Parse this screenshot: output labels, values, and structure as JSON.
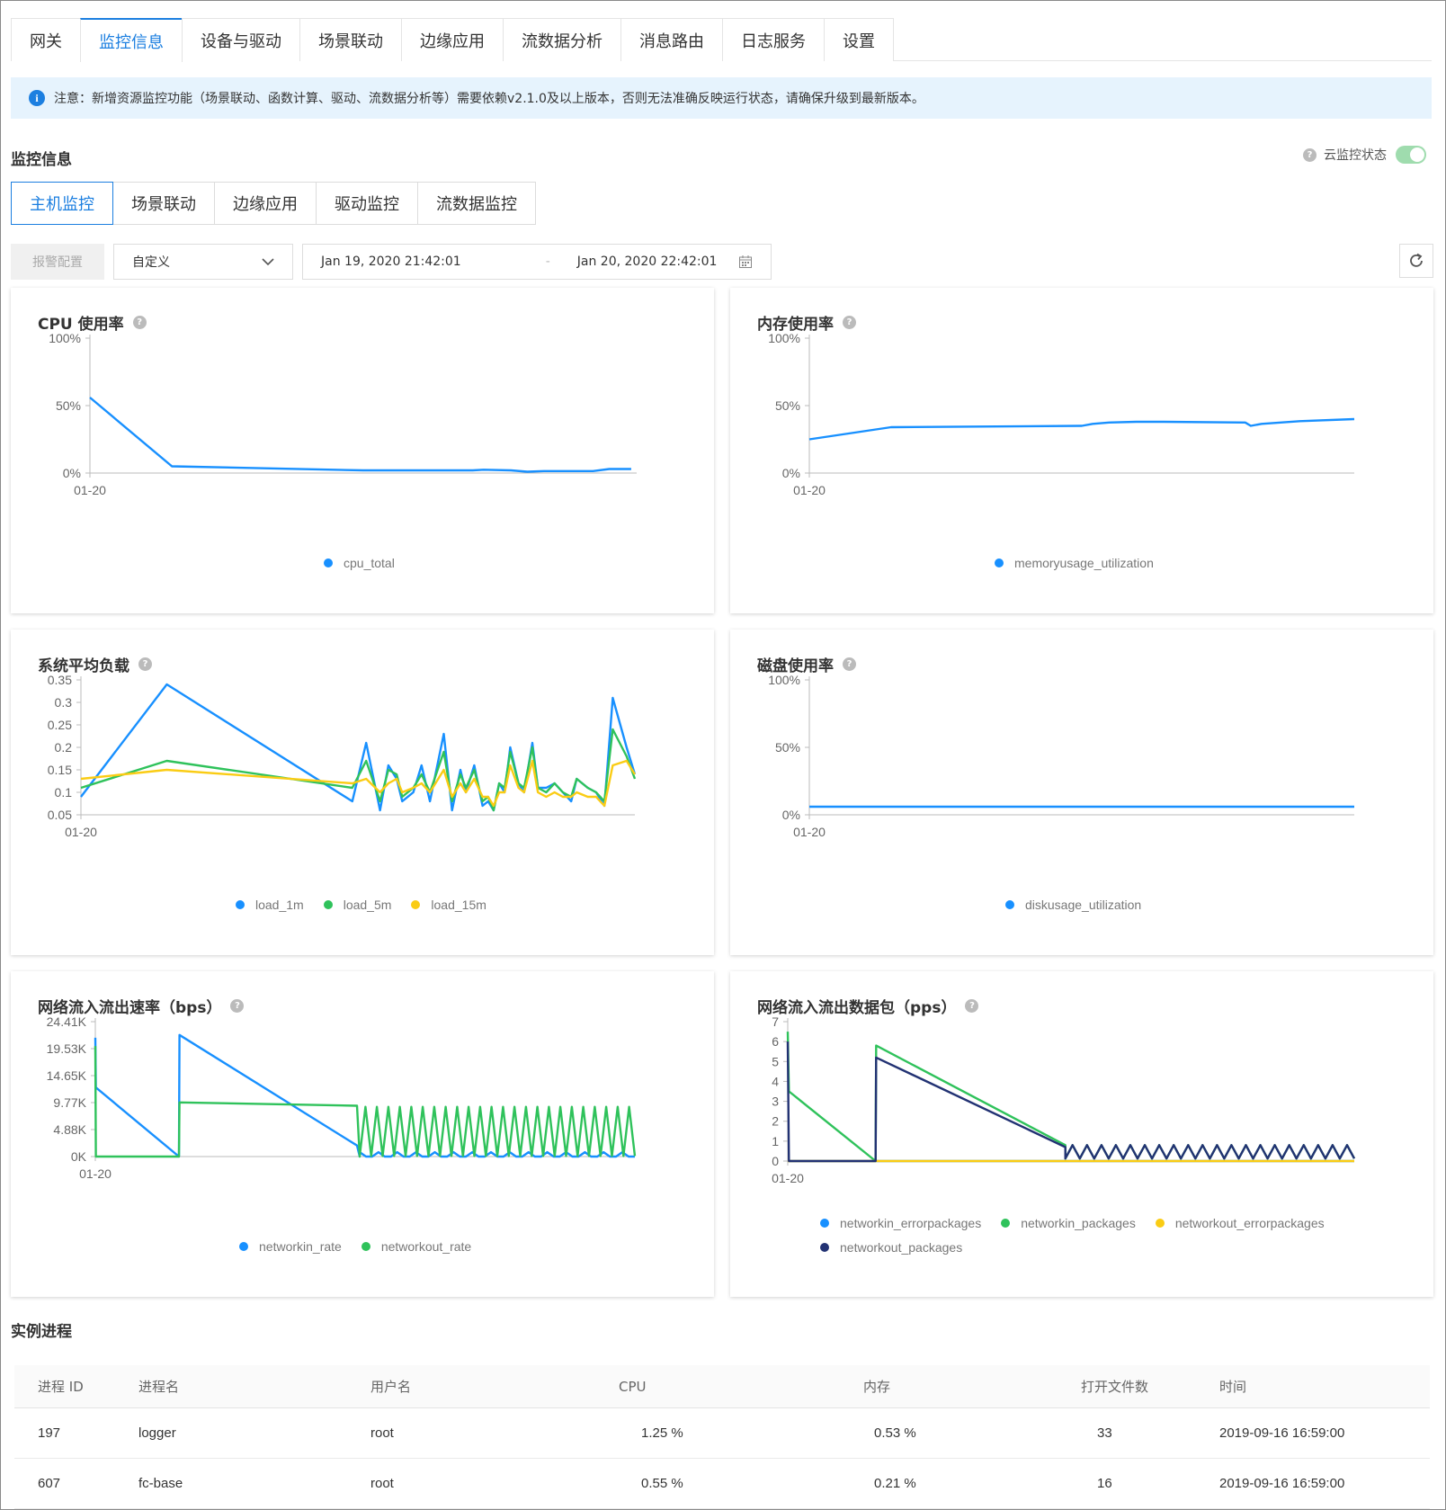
{
  "nav_tabs": [
    {
      "label": "网关"
    },
    {
      "label": "监控信息"
    },
    {
      "label": "设备与驱动"
    },
    {
      "label": "场景联动"
    },
    {
      "label": "边缘应用"
    },
    {
      "label": "流数据分析"
    },
    {
      "label": "消息路由"
    },
    {
      "label": "日志服务"
    },
    {
      "label": "设置"
    }
  ],
  "active_tab": "监控信息",
  "notice": "注意：新增资源监控功能（场景联动、函数计算、驱动、流数据分析等）需要依赖v2.1.0及以上版本，否则无法准确反映运行状态，请确保升级到最新版本。",
  "section_title": "监控信息",
  "cloud_status_label": "云监控状态",
  "cloud_status_on": true,
  "sub_tabs": [
    {
      "label": "主机监控"
    },
    {
      "label": "场景联动"
    },
    {
      "label": "边缘应用"
    },
    {
      "label": "驱动监控"
    },
    {
      "label": "流数据监控"
    }
  ],
  "active_sub_tab": "主机监控",
  "alarm_button": "报警配置",
  "time_select": "自定义",
  "date_start": "Jan 19, 2020 21:42:01",
  "date_sep": "-",
  "date_end": "Jan 20, 2020 22:42:01",
  "colors": {
    "blue": "#1890ff",
    "green": "#2fc25b",
    "yellow": "#facc14",
    "navy": "#223273",
    "accent": "#1c7fe0"
  },
  "chart_data": [
    {
      "id": "cpu",
      "type": "line",
      "title": "CPU 使用率",
      "x_ticks": [
        "01-20"
      ],
      "y_ticks": [
        "100%",
        "50%",
        "0%"
      ],
      "ylim": [
        0,
        100
      ],
      "legend": [
        "cpu_total"
      ],
      "series": [
        {
          "name": "cpu_total",
          "color": "blue",
          "values": [
            [
              0,
              56
            ],
            [
              15,
              5
            ],
            [
              50,
              2
            ],
            [
              55,
              2
            ],
            [
              70,
              2
            ],
            [
              72,
              2.5
            ],
            [
              77,
              2
            ],
            [
              80,
              1
            ],
            [
              83,
              1.5
            ],
            [
              88,
              1.5
            ],
            [
              92,
              1.5
            ],
            [
              95,
              3
            ],
            [
              99,
              3
            ]
          ]
        }
      ]
    },
    {
      "id": "mem",
      "type": "line",
      "title": "内存使用率",
      "x_ticks": [
        "01-20"
      ],
      "y_ticks": [
        "100%",
        "50%",
        "0%"
      ],
      "ylim": [
        0,
        100
      ],
      "legend": [
        "memoryusage_utilization"
      ],
      "series": [
        {
          "name": "memoryusage_utilization",
          "color": "blue",
          "values": [
            [
              0,
              25
            ],
            [
              15,
              34
            ],
            [
              50,
              35
            ],
            [
              52,
              36.5
            ],
            [
              55,
              37.5
            ],
            [
              60,
              38
            ],
            [
              65,
              38
            ],
            [
              80,
              37.5
            ],
            [
              81,
              35
            ],
            [
              83,
              36.5
            ],
            [
              90,
              38.5
            ],
            [
              100,
              40
            ]
          ]
        }
      ]
    },
    {
      "id": "load",
      "type": "line",
      "title": "系统平均负载",
      "x_ticks": [
        "01-20"
      ],
      "y_ticks": [
        "0.35",
        "0.3",
        "0.25",
        "0.2",
        "0.15",
        "0.1",
        "0.05"
      ],
      "ylim": [
        0.05,
        0.35
      ],
      "legend": [
        "load_1m",
        "load_5m",
        "load_15m"
      ],
      "series": [
        {
          "name": "load_1m",
          "color": "blue",
          "values": [
            [
              0,
              0.09
            ],
            [
              15.5,
              0.34
            ],
            [
              49,
              0.08
            ],
            [
              51.5,
              0.21
            ],
            [
              54,
              0.06
            ],
            [
              55.5,
              0.16
            ],
            [
              57,
              0.13
            ],
            [
              58,
              0.08
            ],
            [
              60,
              0.1
            ],
            [
              61.5,
              0.16
            ],
            [
              63,
              0.08
            ],
            [
              65.5,
              0.23
            ],
            [
              67,
              0.06
            ],
            [
              68.5,
              0.15
            ],
            [
              69.5,
              0.1
            ],
            [
              71,
              0.16
            ],
            [
              72.5,
              0.07
            ],
            [
              73.5,
              0.08
            ],
            [
              74.5,
              0.06
            ],
            [
              75.5,
              0.12
            ],
            [
              76.5,
              0.1
            ],
            [
              77.5,
              0.2
            ],
            [
              79,
              0.12
            ],
            [
              80,
              0.1
            ],
            [
              81.5,
              0.21
            ],
            [
              82.5,
              0.11
            ],
            [
              84,
              0.11
            ],
            [
              85.5,
              0.12
            ],
            [
              87,
              0.1
            ],
            [
              88.5,
              0.08
            ],
            [
              89.5,
              0.13
            ],
            [
              91.5,
              0.11
            ],
            [
              93,
              0.1
            ],
            [
              94.5,
              0.07
            ],
            [
              96,
              0.31
            ],
            [
              98.5,
              0.2
            ],
            [
              100,
              0.14
            ]
          ]
        },
        {
          "name": "load_5m",
          "color": "green",
          "values": [
            [
              0,
              0.11
            ],
            [
              15.5,
              0.17
            ],
            [
              49,
              0.11
            ],
            [
              51.5,
              0.17
            ],
            [
              54,
              0.08
            ],
            [
              55.5,
              0.15
            ],
            [
              57,
              0.14
            ],
            [
              58,
              0.09
            ],
            [
              60,
              0.11
            ],
            [
              61.5,
              0.14
            ],
            [
              63,
              0.1
            ],
            [
              65.5,
              0.19
            ],
            [
              67,
              0.08
            ],
            [
              68.5,
              0.14
            ],
            [
              69.5,
              0.11
            ],
            [
              71,
              0.15
            ],
            [
              72.5,
              0.08
            ],
            [
              73.5,
              0.09
            ],
            [
              74.5,
              0.06
            ],
            [
              75.5,
              0.12
            ],
            [
              76.5,
              0.11
            ],
            [
              77.5,
              0.19
            ],
            [
              79,
              0.12
            ],
            [
              80,
              0.11
            ],
            [
              81.5,
              0.2
            ],
            [
              82.5,
              0.11
            ],
            [
              84,
              0.1
            ],
            [
              85.5,
              0.12
            ],
            [
              87,
              0.1
            ],
            [
              88.5,
              0.09
            ],
            [
              89.5,
              0.13
            ],
            [
              91.5,
              0.11
            ],
            [
              93,
              0.1
            ],
            [
              94.5,
              0.08
            ],
            [
              96,
              0.24
            ],
            [
              98.5,
              0.18
            ],
            [
              100,
              0.13
            ]
          ]
        },
        {
          "name": "load_15m",
          "color": "yellow",
          "values": [
            [
              0,
              0.13
            ],
            [
              15.5,
              0.15
            ],
            [
              49,
              0.12
            ],
            [
              51.5,
              0.13
            ],
            [
              54,
              0.1
            ],
            [
              55.5,
              0.12
            ],
            [
              57,
              0.13
            ],
            [
              58,
              0.1
            ],
            [
              60,
              0.11
            ],
            [
              61.5,
              0.12
            ],
            [
              63,
              0.1
            ],
            [
              65.5,
              0.15
            ],
            [
              67,
              0.09
            ],
            [
              68.5,
              0.12
            ],
            [
              69.5,
              0.1
            ],
            [
              71,
              0.13
            ],
            [
              72.5,
              0.09
            ],
            [
              73.5,
              0.09
            ],
            [
              74.5,
              0.07
            ],
            [
              75.5,
              0.1
            ],
            [
              76.5,
              0.1
            ],
            [
              77.5,
              0.16
            ],
            [
              79,
              0.11
            ],
            [
              80,
              0.1
            ],
            [
              81.5,
              0.17
            ],
            [
              82.5,
              0.1
            ],
            [
              84,
              0.09
            ],
            [
              85.5,
              0.1
            ],
            [
              87,
              0.09
            ],
            [
              88.5,
              0.09
            ],
            [
              89.5,
              0.1
            ],
            [
              91.5,
              0.09
            ],
            [
              93,
              0.09
            ],
            [
              94.5,
              0.07
            ],
            [
              96,
              0.16
            ],
            [
              98.5,
              0.17
            ],
            [
              100,
              0.14
            ]
          ]
        }
      ]
    },
    {
      "id": "disk",
      "type": "line",
      "title": "磁盘使用率",
      "x_ticks": [
        "01-20"
      ],
      "y_ticks": [
        "100%",
        "50%",
        "0%"
      ],
      "ylim": [
        0,
        100
      ],
      "legend": [
        "diskusage_utilization"
      ],
      "series": [
        {
          "name": "diskusage_utilization",
          "color": "blue",
          "values": [
            [
              0,
              6
            ],
            [
              100,
              6
            ]
          ]
        }
      ]
    },
    {
      "id": "net_rate",
      "type": "line",
      "title": "网络流入流出速率（bps）",
      "x_ticks": [
        "01-20"
      ],
      "y_ticks": [
        "24.41K",
        "19.53K",
        "14.65K",
        "9.77K",
        "4.88K",
        "0K"
      ],
      "ylim": [
        0,
        24.41
      ],
      "legend": [
        "networkin_rate",
        "networkout_rate"
      ],
      "series": [
        {
          "name": "networkin_rate",
          "color": "blue",
          "values": [
            [
              0,
              21.5
            ],
            [
              0.1,
              12.5
            ],
            [
              15.5,
              0
            ],
            [
              15.6,
              22
            ],
            [
              48.5,
              2
            ],
            [
              49,
              0
            ],
            [
              100,
              0
            ]
          ],
          "jitter": "low"
        },
        {
          "name": "networkout_rate",
          "color": "green",
          "values": [
            [
              0,
              20
            ],
            [
              0.1,
              0
            ],
            [
              15.5,
              0
            ],
            [
              15.6,
              9.8
            ],
            [
              48.5,
              9.2
            ],
            [
              49,
              0
            ],
            [
              100,
              9
            ]
          ],
          "jitter": "high"
        }
      ]
    },
    {
      "id": "net_pkts",
      "type": "line",
      "title": "网络流入流出数据包（pps）",
      "x_ticks": [
        "01-20"
      ],
      "y_ticks": [
        "7",
        "6",
        "5",
        "4",
        "3",
        "2",
        "1",
        "0"
      ],
      "ylim": [
        0,
        7
      ],
      "legend": [
        "networkin_errorpackages",
        "networkin_packages",
        "networkout_errorpackages",
        "networkout_packages"
      ],
      "series": [
        {
          "name": "networkin_errorpackages",
          "color": "blue",
          "values": [
            [
              0,
              0
            ],
            [
              100,
              0
            ]
          ]
        },
        {
          "name": "networkin_packages",
          "color": "green",
          "values": [
            [
              0,
              6.5
            ],
            [
              0.2,
              3.5
            ],
            [
              15.5,
              0
            ],
            [
              15.6,
              5.8
            ],
            [
              49,
              0.8
            ],
            [
              100,
              0.5
            ]
          ],
          "jitter": "mid"
        },
        {
          "name": "networkout_errorpackages",
          "color": "yellow",
          "values": [
            [
              0,
              0
            ],
            [
              100,
              0
            ]
          ]
        },
        {
          "name": "networkout_packages",
          "color": "navy",
          "values": [
            [
              0,
              6
            ],
            [
              0.2,
              0
            ],
            [
              15.5,
              0
            ],
            [
              15.6,
              5.2
            ],
            [
              49,
              0.7
            ],
            [
              100,
              0.5
            ]
          ],
          "jitter": "mid"
        }
      ]
    }
  ],
  "process_title": "实例进程",
  "process_table": {
    "headers": [
      "进程 ID",
      "进程名",
      "用户名",
      "CPU",
      "内存",
      "打开文件数",
      "时间"
    ],
    "rows": [
      [
        "197",
        "logger",
        "root",
        "1.25 %",
        "0.53 %",
        "33",
        "2019-09-16 16:59:00"
      ],
      [
        "607",
        "fc-base",
        "root",
        "0.55 %",
        "0.21 %",
        "16",
        "2019-09-16 16:59:00"
      ]
    ]
  }
}
